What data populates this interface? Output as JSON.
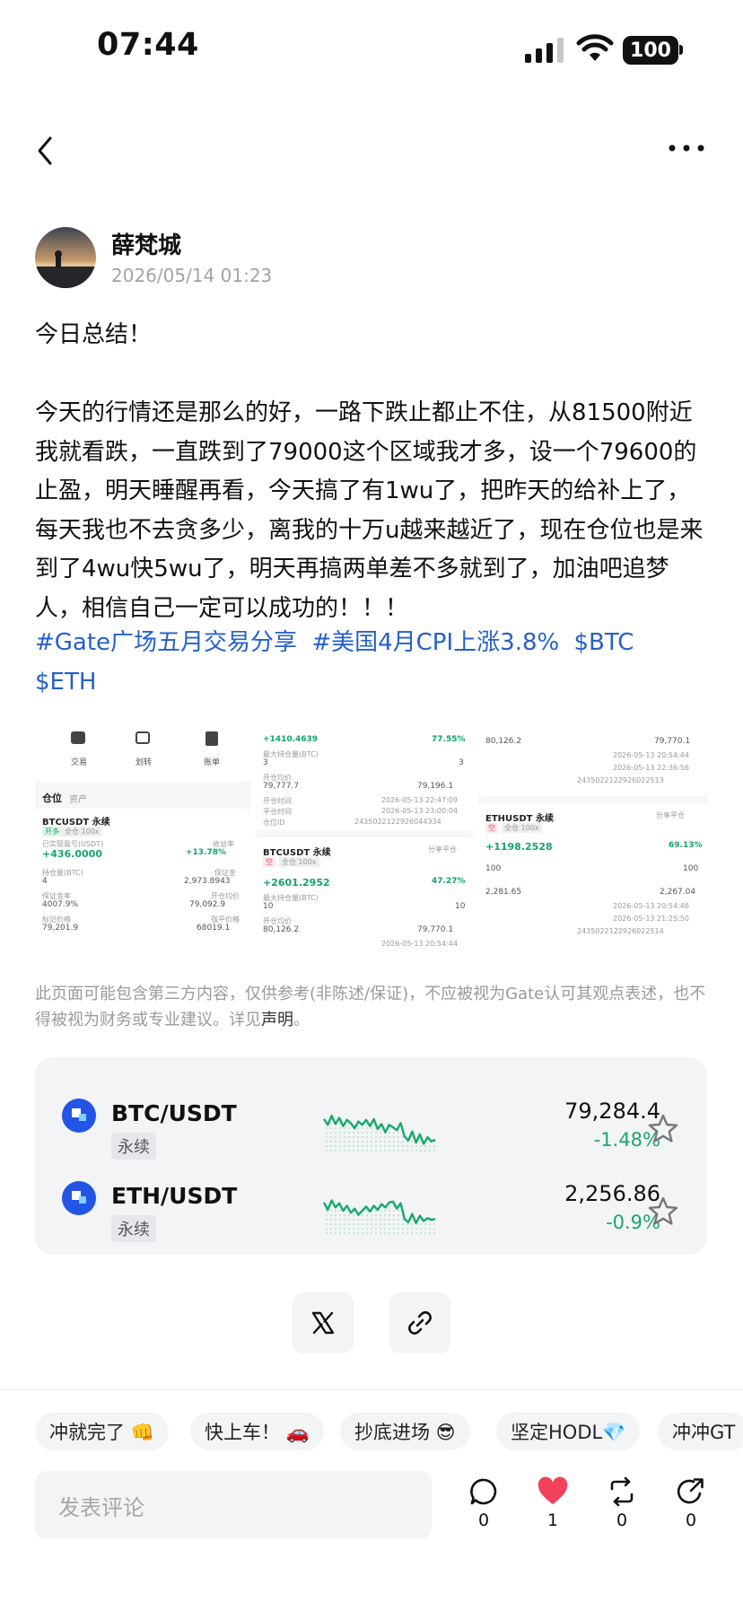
{
  "status_bar": {
    "time": "07:44",
    "battery": "100"
  },
  "author": {
    "name": "薛梵城",
    "date": "2026/05/14 01:23"
  },
  "post": {
    "text": "今日总结！\n\n今天的行情还是那么的好，一路下跌止都止不住，从81500附近我就看跌，一直跌到了79000这个区域我才多，设一个79600的止盈，明天睡醒再看，今天搞了有1wu了，把昨天的给补上了，每天我也不去贪多少，离我的十万u越来越近了，现在仓位也是来到了4wu快5wu了，明天再搞两单差不多就到了，加油吧追梦人，相信自己一定可以成功的！！！",
    "tags": [
      "#Gate广场五月交易分享",
      "#美国4月CPI上涨3.8%",
      "$BTC",
      "$ETH"
    ]
  },
  "screenshots": {
    "s1": {
      "tabs": [
        "交易",
        "划转",
        "账单"
      ],
      "position_tab": "仓位",
      "assets_tab": "资产",
      "symbol": "BTCUSDT 永续",
      "badge1": "开多",
      "badge2": "全仓 100x",
      "pnl_label": "已实现盈亏(USDT)",
      "pnl": "+436.0000",
      "roe_label": "收益率",
      "roe": "+13.78%",
      "r1l": "持仓量(BTC)",
      "r1v": "4",
      "r1rl": "保证金",
      "r1rv": "2,973.8943",
      "r2l": "保证金率",
      "r2v": "4007.9%",
      "r2rl": "开仓均价",
      "r2rv": "79,092.9",
      "r3l": "标记价格",
      "r3v": "79,201.9",
      "r3rl": "强平价格",
      "r3rv": "68019.1"
    },
    "s2": {
      "pnl": "+1410.4639",
      "roe": "77.55%",
      "max_label": "最大持仓量(BTC)",
      "max_l": "3",
      "max_r": "3",
      "open_label": "开仓均价",
      "open_l": "79,777.7",
      "open_r": "79,196.1",
      "time_label": "开仓时间",
      "time_val": "2026-05-13 22:47:09",
      "close_label": "平仓时间",
      "close_val": "2026-05-13 23:00:04",
      "id_label": "仓位ID",
      "id_val": "2435022122926044334",
      "symbol": "BTCUSDT 永续",
      "share": "分享平仓",
      "badge1": "空",
      "badge2": "全仓 100x",
      "pnl2": "+2601.2952",
      "roe2": "47.27%",
      "max2_l": "10",
      "max2_r": "10",
      "open2_l": "80,126.2",
      "open2_r": "79,770.1",
      "time2_val": "2026-05-13 20:54:44"
    },
    "s3": {
      "open_l": "80,126.2",
      "open_r": "79,770.1",
      "time_val": "2026-05-13 20:54:44",
      "close_val": "2026-05-13 22:36:56",
      "id_val": "2435022122926022513",
      "symbol": "ETHUSDT 永续",
      "share": "分享平仓",
      "badge1": "空",
      "badge2": "全仓 100x",
      "pnl": "+1198.2528",
      "roe": "69.13%",
      "max_l": "100",
      "max_r": "100",
      "open2_l": "2,281.65",
      "open2_r": "2,267.04",
      "time2_val": "2026-05-13 20:54:46",
      "close2_val": "2026-05-13 21:25:50",
      "id2_val": "2435022122926022514"
    }
  },
  "disclaimer": {
    "text": "此页面可能包含第三方内容，仅供参考(非陈述/保证)，不应被视为Gate认可其观点表述，也不得被视为财务或专业建议。详见",
    "link": "声明",
    "end": "。"
  },
  "markets": [
    {
      "pair": "BTC/USDT",
      "type": "永续",
      "price": "79,284.4",
      "change": "-1.48%",
      "spark": [
        0.72,
        0.58,
        0.8,
        0.6,
        0.75,
        0.55,
        0.7,
        0.62,
        0.5,
        0.66,
        0.58,
        0.7,
        0.55,
        0.72,
        0.48,
        0.6,
        0.4,
        0.58,
        0.52,
        0.45,
        0.62,
        0.3,
        0.2,
        0.42,
        0.15,
        0.35,
        0.12,
        0.28,
        0.18,
        0.22
      ]
    },
    {
      "pair": "ETH/USDT",
      "type": "永续",
      "price": "2,256.86",
      "change": "-0.9%",
      "spark": [
        0.7,
        0.52,
        0.75,
        0.58,
        0.68,
        0.5,
        0.62,
        0.45,
        0.55,
        0.4,
        0.5,
        0.6,
        0.48,
        0.62,
        0.52,
        0.66,
        0.58,
        0.7,
        0.72,
        0.55,
        0.68,
        0.3,
        0.22,
        0.42,
        0.2,
        0.38,
        0.25,
        0.32,
        0.28,
        0.3
      ]
    }
  ],
  "chips": [
    "冲就完了 👊",
    "快上车！ 🚗",
    "抄底进场 😎",
    "坚定HODL💎",
    "冲冲GT"
  ],
  "comment_placeholder": "发表评论",
  "actions": [
    {
      "name": "comment",
      "count": "0"
    },
    {
      "name": "like",
      "count": "1"
    },
    {
      "name": "repost",
      "count": "0"
    },
    {
      "name": "share",
      "count": "0"
    }
  ],
  "colors": {
    "tag": "#2560c9",
    "down": "#18a96a",
    "like": "#f2415a",
    "brand": "#2354e6"
  }
}
